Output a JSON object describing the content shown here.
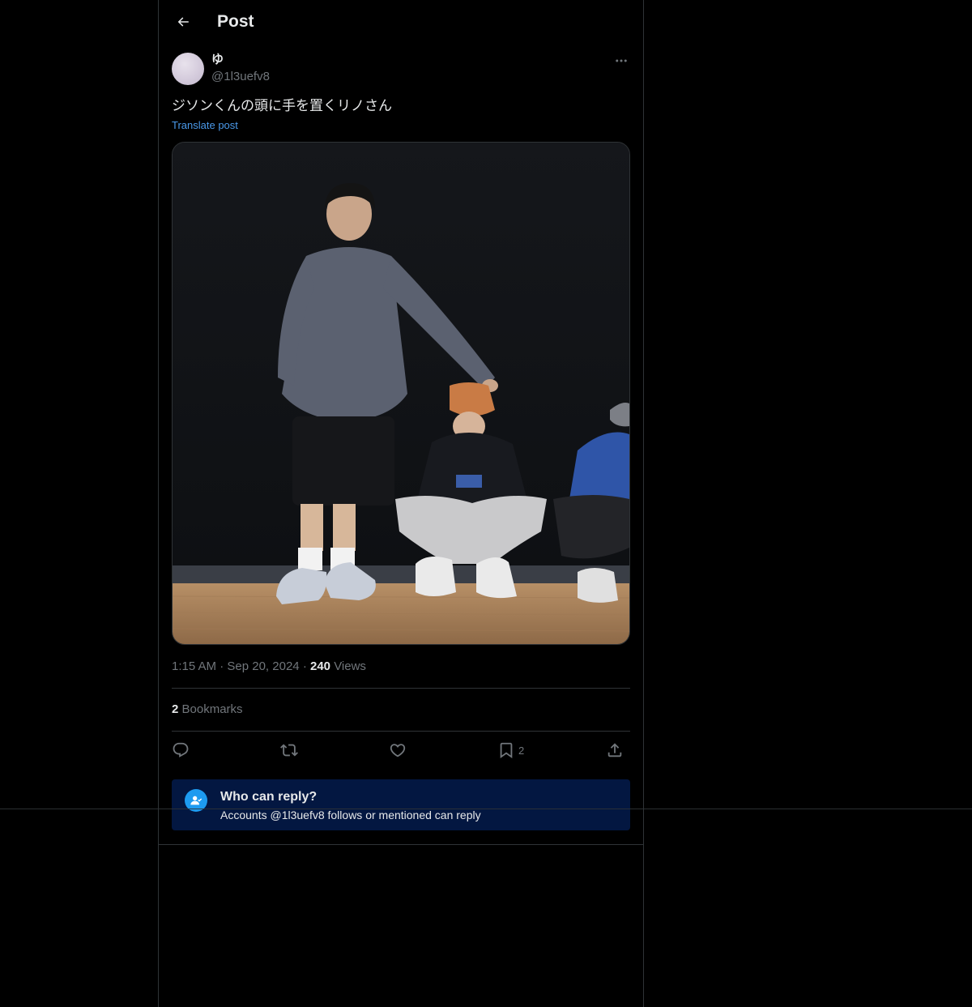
{
  "header": {
    "title": "Post"
  },
  "post": {
    "author": {
      "display_name": "ゆ",
      "handle": "@1l3uefv8"
    },
    "text": "ジソンくんの頭に手を置くリノさん",
    "translate_label": "Translate post",
    "time": "1:15 AM",
    "date": "Sep 20, 2024",
    "views_count": "240",
    "views_label": "Views",
    "bookmarks_count": "2",
    "bookmarks_label": "Bookmarks",
    "actions": {
      "reply_icon": "reply-icon",
      "repost_icon": "repost-icon",
      "like_icon": "heart-icon",
      "bookmark_icon": "bookmark-icon",
      "bookmark_count": "2",
      "share_icon": "share-icon"
    }
  },
  "reply_restriction": {
    "title": "Who can reply?",
    "subtitle": "Accounts @1l3uefv8 follows or mentioned can reply"
  },
  "colors": {
    "background": "#000000",
    "text_primary": "#e7e9ea",
    "text_secondary": "#71767b",
    "accent": "#1d9bf0",
    "link": "#4a99e9",
    "reply_box": "#031741",
    "border": "#2f3336"
  }
}
